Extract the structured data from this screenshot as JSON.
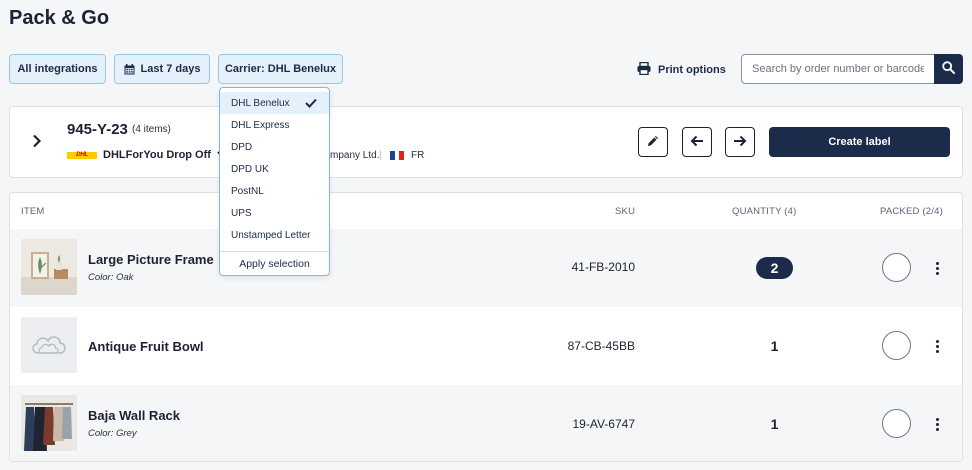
{
  "page": {
    "title": "Pack & Go"
  },
  "filters": {
    "integrations_label": "All integrations",
    "date_label": "Last 7 days",
    "carrier_label": "Carrier: DHL Benelux",
    "calendar_icon": "calendar-icon"
  },
  "print": {
    "label": "Print options",
    "icon": "printer-icon"
  },
  "search": {
    "placeholder": "Search by order number or barcode",
    "value": "",
    "icon": "search-icon"
  },
  "carrier_dropdown": {
    "options": [
      {
        "label": "DHL Benelux",
        "selected": true
      },
      {
        "label": "DHL Express",
        "selected": false
      },
      {
        "label": "DPD",
        "selected": false
      },
      {
        "label": "DPD UK",
        "selected": false
      },
      {
        "label": "PostNL",
        "selected": false
      },
      {
        "label": "UPS",
        "selected": false
      },
      {
        "label": "Unstamped Letter",
        "selected": false
      }
    ],
    "apply_label": "Apply selection"
  },
  "order": {
    "id": "945-Y-23",
    "item_count": "(4 items)",
    "carrier_logo_text": "DHL",
    "carrier_service": "DHLForYou Drop Off",
    "company": "mpany Ltd.",
    "separator": "|",
    "country": "FR",
    "flag_colors": [
      "#1f3f99",
      "#ffffff",
      "#e1231c"
    ],
    "create_label": "Create label"
  },
  "table": {
    "headers": {
      "item": "ITEM",
      "sku": "SKU",
      "quantity": "QUANTITY (4)",
      "packed": "PACKED (2/4)"
    },
    "rows": [
      {
        "name": "Large Picture Frame",
        "variant": "Color: Oak",
        "sku": "41-FB-2010",
        "quantity": "2",
        "highlight": true
      },
      {
        "name": "Antique Fruit Bowl",
        "variant": "",
        "sku": "87-CB-45BB",
        "quantity": "1",
        "highlight": false
      },
      {
        "name": "Baja Wall Rack",
        "variant": "Color: Grey",
        "sku": "19-AV-6747",
        "quantity": "1",
        "highlight": false
      }
    ]
  },
  "colors": {
    "primary": "#1c2b4a",
    "chip_bg": "#e4f0fa",
    "chip_border": "#9cc6e6",
    "dhl_yellow": "#ffcc00",
    "dhl_red": "#d40511"
  }
}
